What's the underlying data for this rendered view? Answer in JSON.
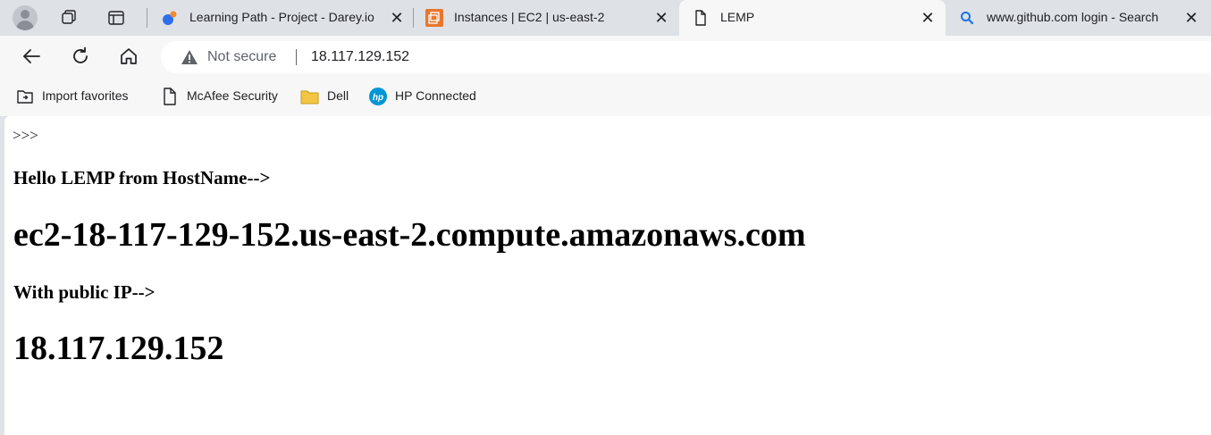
{
  "tabs": [
    {
      "title": "Learning Path - Project - Darey.io",
      "icon": "darey-icon",
      "active": false
    },
    {
      "title": "Instances | EC2 | us-east-2",
      "icon": "aws-ec2-icon",
      "active": false
    },
    {
      "title": "LEMP",
      "icon": "page-icon",
      "active": true
    },
    {
      "title": "www.github.com login - Search",
      "icon": "search-icon",
      "active": false
    }
  ],
  "address_bar": {
    "security_label": "Not secure",
    "url": "18.117.129.152"
  },
  "favorites": [
    {
      "label": "Import favorites",
      "icon": "import-favorites-icon"
    },
    {
      "label": "McAfee Security",
      "icon": "page-icon"
    },
    {
      "label": "Dell",
      "icon": "folder-icon"
    },
    {
      "label": "HP Connected",
      "icon": "hp-icon"
    }
  ],
  "page": {
    "prefix": ">>>",
    "hostname_heading": "Hello LEMP from HostName-->",
    "hostname": "ec2-18-117-129-152.us-east-2.compute.amazonaws.com",
    "ip_heading": "With public IP-->",
    "ip": "18.117.129.152"
  },
  "colors": {
    "tabstrip": "#dee1e5",
    "toolbar": "#f7f7f7",
    "aws_orange": "#e8772e",
    "hp_blue": "#0096d6",
    "folder_yellow": "#f4c542"
  }
}
